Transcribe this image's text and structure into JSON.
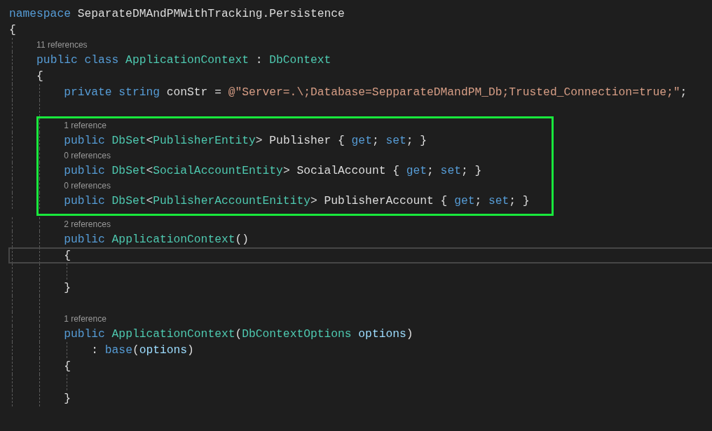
{
  "editor": {
    "lines": [
      {
        "kind": "code",
        "tokens": [
          {
            "kind": "keyword",
            "text": "namespace "
          },
          {
            "kind": "plain",
            "text": "SeparateDMAndPMWithTracking.Persistence"
          }
        ]
      },
      {
        "kind": "code",
        "tokens": [
          {
            "kind": "plain",
            "text": "{"
          }
        ],
        "children": [
          {
            "kind": "lens",
            "text": "11 references"
          },
          {
            "kind": "code",
            "tokens": [
              {
                "kind": "keyword",
                "text": "public class "
              },
              {
                "kind": "type",
                "text": "ApplicationContext"
              },
              {
                "kind": "plain",
                "text": " : "
              },
              {
                "kind": "type",
                "text": "DbContext"
              }
            ]
          },
          {
            "kind": "code",
            "tokens": [
              {
                "kind": "plain",
                "text": "{"
              }
            ],
            "children": [
              {
                "kind": "code",
                "tokens": [
                  {
                    "kind": "keyword",
                    "text": "private string "
                  },
                  {
                    "kind": "plain",
                    "text": "conStr = "
                  },
                  {
                    "kind": "string",
                    "text": "@\"Server=.\\;Database=SepparateDMandPM_Db;Trusted_Connection=true;\""
                  },
                  {
                    "kind": "plain",
                    "text": ";"
                  }
                ]
              },
              {
                "kind": "blank"
              },
              {
                "kind": "group",
                "highlighted": true,
                "children": [
                  {
                    "kind": "lens",
                    "text": "1 reference"
                  },
                  {
                    "kind": "code",
                    "tokens": [
                      {
                        "kind": "keyword",
                        "text": "public "
                      },
                      {
                        "kind": "type",
                        "text": "DbSet"
                      },
                      {
                        "kind": "plain",
                        "text": "<"
                      },
                      {
                        "kind": "type",
                        "text": "PublisherEntity"
                      },
                      {
                        "kind": "plain",
                        "text": "> Publisher { "
                      },
                      {
                        "kind": "keyword",
                        "text": "get"
                      },
                      {
                        "kind": "plain",
                        "text": "; "
                      },
                      {
                        "kind": "keyword",
                        "text": "set"
                      },
                      {
                        "kind": "plain",
                        "text": "; }"
                      }
                    ]
                  },
                  {
                    "kind": "lens",
                    "text": "0 references"
                  },
                  {
                    "kind": "code",
                    "tokens": [
                      {
                        "kind": "keyword",
                        "text": "public "
                      },
                      {
                        "kind": "type",
                        "text": "DbSet"
                      },
                      {
                        "kind": "plain",
                        "text": "<"
                      },
                      {
                        "kind": "type",
                        "text": "SocialAccountEntity"
                      },
                      {
                        "kind": "plain",
                        "text": "> SocialAccount { "
                      },
                      {
                        "kind": "keyword",
                        "text": "get"
                      },
                      {
                        "kind": "plain",
                        "text": "; "
                      },
                      {
                        "kind": "keyword",
                        "text": "set"
                      },
                      {
                        "kind": "plain",
                        "text": "; }"
                      }
                    ]
                  },
                  {
                    "kind": "lens",
                    "text": "0 references"
                  },
                  {
                    "kind": "code",
                    "tokens": [
                      {
                        "kind": "keyword",
                        "text": "public "
                      },
                      {
                        "kind": "type",
                        "text": "DbSet"
                      },
                      {
                        "kind": "plain",
                        "text": "<"
                      },
                      {
                        "kind": "type",
                        "text": "PublisherAccountEnitity"
                      },
                      {
                        "kind": "plain",
                        "text": "> PublisherAccount { "
                      },
                      {
                        "kind": "keyword",
                        "text": "get"
                      },
                      {
                        "kind": "plain",
                        "text": "; "
                      },
                      {
                        "kind": "keyword",
                        "text": "set"
                      },
                      {
                        "kind": "plain",
                        "text": "; }"
                      }
                    ]
                  }
                ]
              },
              {
                "kind": "lens",
                "text": "2 references"
              },
              {
                "kind": "code",
                "tokens": [
                  {
                    "kind": "keyword",
                    "text": "public "
                  },
                  {
                    "kind": "type",
                    "text": "ApplicationContext"
                  },
                  {
                    "kind": "plain",
                    "text": "()"
                  }
                ]
              },
              {
                "kind": "code",
                "current": true,
                "tokens": [
                  {
                    "kind": "plain",
                    "text": "{"
                  }
                ],
                "children": [
                  {
                    "kind": "blank"
                  }
                ]
              },
              {
                "kind": "code",
                "tokens": [
                  {
                    "kind": "plain",
                    "text": "}"
                  }
                ]
              },
              {
                "kind": "blank"
              },
              {
                "kind": "lens",
                "text": "1 reference"
              },
              {
                "kind": "code",
                "tokens": [
                  {
                    "kind": "keyword",
                    "text": "public "
                  },
                  {
                    "kind": "type",
                    "text": "ApplicationContext"
                  },
                  {
                    "kind": "plain",
                    "text": "("
                  },
                  {
                    "kind": "type",
                    "text": "DbContextOptions"
                  },
                  {
                    "kind": "param",
                    "text": " options"
                  },
                  {
                    "kind": "plain",
                    "text": ")"
                  }
                ],
                "children": [
                  {
                    "kind": "code",
                    "tokens": [
                      {
                        "kind": "plain",
                        "text": ": "
                      },
                      {
                        "kind": "keyword",
                        "text": "base"
                      },
                      {
                        "kind": "plain",
                        "text": "("
                      },
                      {
                        "kind": "param",
                        "text": "options"
                      },
                      {
                        "kind": "plain",
                        "text": ")"
                      }
                    ]
                  }
                ]
              },
              {
                "kind": "code",
                "tokens": [
                  {
                    "kind": "plain",
                    "text": "{"
                  }
                ],
                "children": [
                  {
                    "kind": "blank"
                  }
                ]
              },
              {
                "kind": "code",
                "tokens": [
                  {
                    "kind": "plain",
                    "text": "}"
                  }
                ]
              }
            ]
          }
        ]
      }
    ]
  }
}
